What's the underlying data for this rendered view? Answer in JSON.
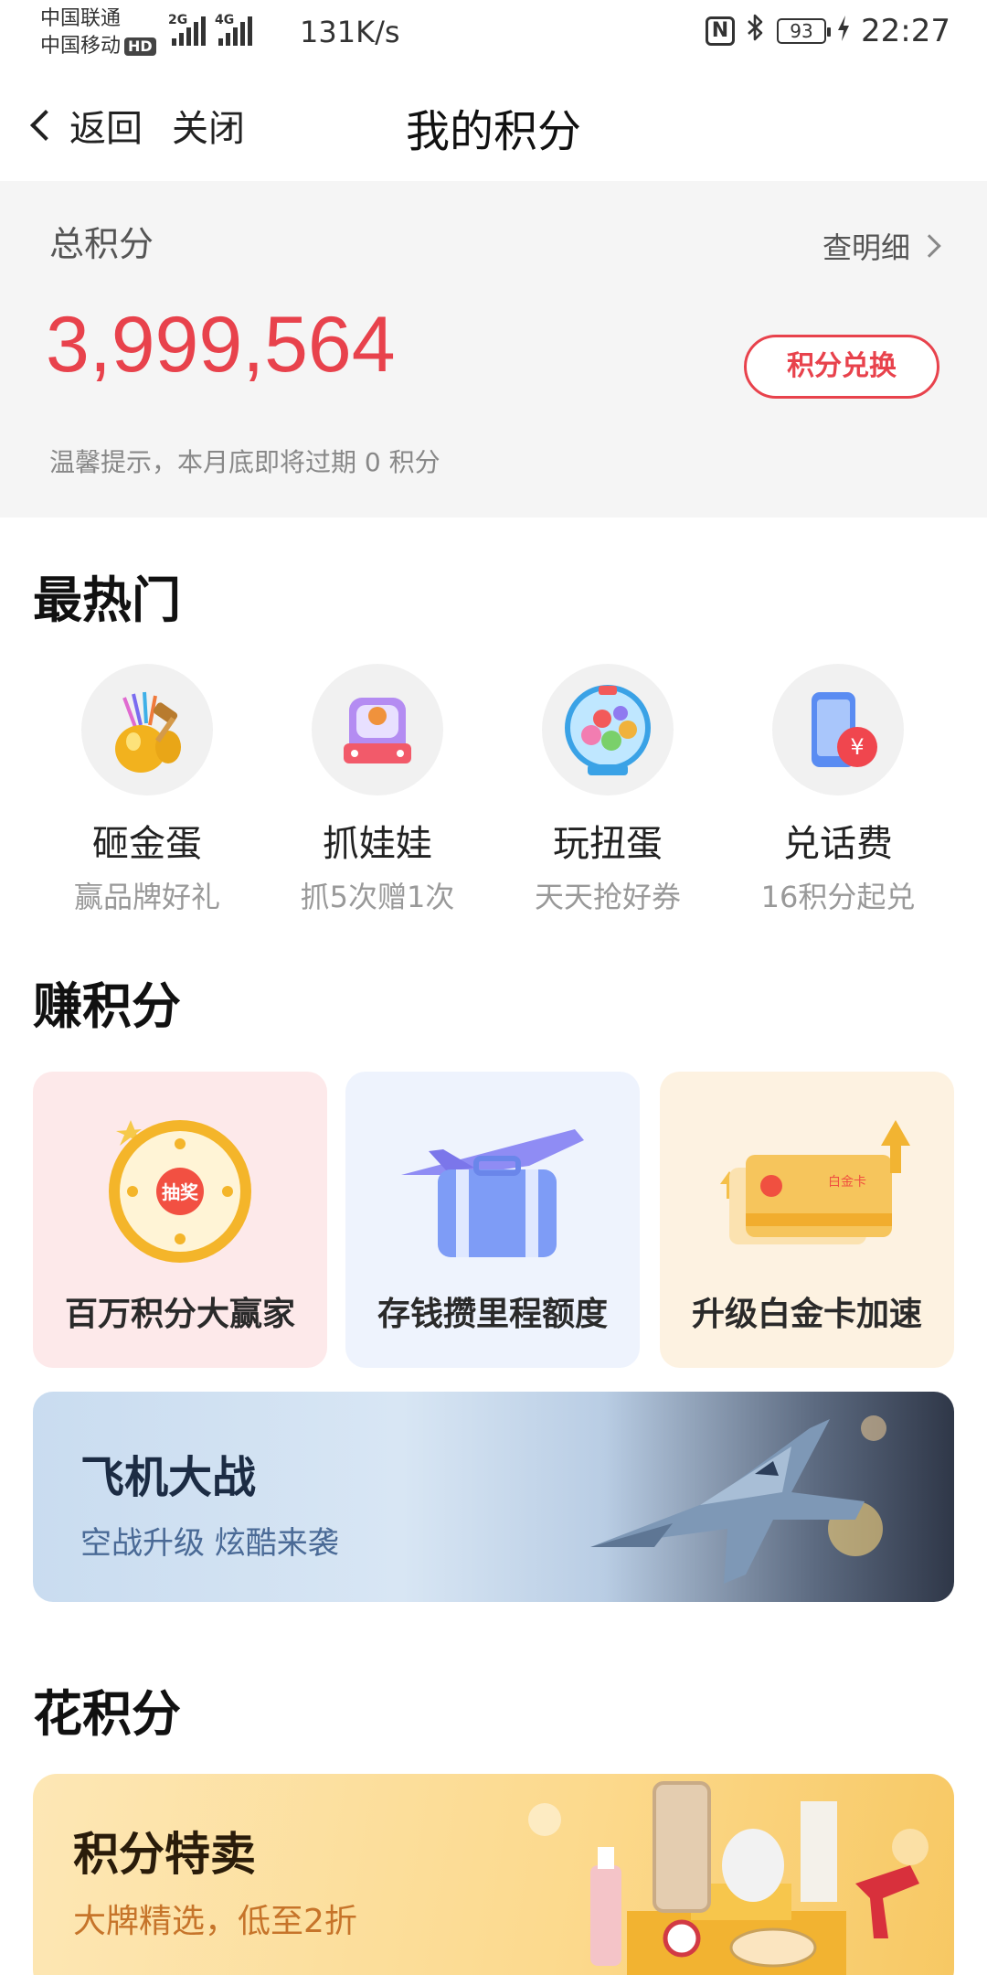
{
  "status_bar": {
    "carrier1": "中国联通",
    "carrier2": "中国移动",
    "hd": "HD",
    "net1": "2G",
    "net2": "4G",
    "speed": "131K/s",
    "nfc": "N",
    "bluetooth_icon": "bluetooth-icon",
    "battery": "93",
    "time": "22:27"
  },
  "nav": {
    "back_label": "返回",
    "close_label": "关闭",
    "title": "我的积分"
  },
  "points": {
    "label": "总积分",
    "detail_link": "查明细",
    "value": "3,999,564",
    "exchange_button": "积分兑换",
    "tip": "温馨提示，本月底即将过期 0 积分",
    "accent_color": "#e8424c"
  },
  "hot": {
    "title": "最热门",
    "items": [
      {
        "name": "砸金蛋",
        "sub": "赢品牌好礼",
        "icon": "golden-egg-icon"
      },
      {
        "name": "抓娃娃",
        "sub": "抓5次赠1次",
        "icon": "claw-machine-icon"
      },
      {
        "name": "玩扭蛋",
        "sub": "天天抢好券",
        "icon": "gashapon-icon"
      },
      {
        "name": "兑话费",
        "sub": "16积分起兑",
        "icon": "phone-recharge-icon"
      }
    ]
  },
  "earn": {
    "title": "赚积分",
    "cards": [
      {
        "label": "百万积分大赢家",
        "icon": "lucky-wheel-icon",
        "bg": "#fde9ea",
        "wheel_center": "抽奖"
      },
      {
        "label": "存钱攒里程额度",
        "icon": "plane-suitcase-icon",
        "bg": "#eef3fd"
      },
      {
        "label": "升级白金卡加速",
        "icon": "platinum-card-icon",
        "bg": "#fdf2e1",
        "card_text": "白金卡"
      }
    ]
  },
  "plane_game": {
    "title": "飞机大战",
    "subtitle": "空战升级  炫酷来袭",
    "icon": "fighter-jet-icon"
  },
  "spend": {
    "title": "花积分",
    "sale_title": "积分特卖",
    "sale_subtitle": "大牌精选，低至2折"
  }
}
